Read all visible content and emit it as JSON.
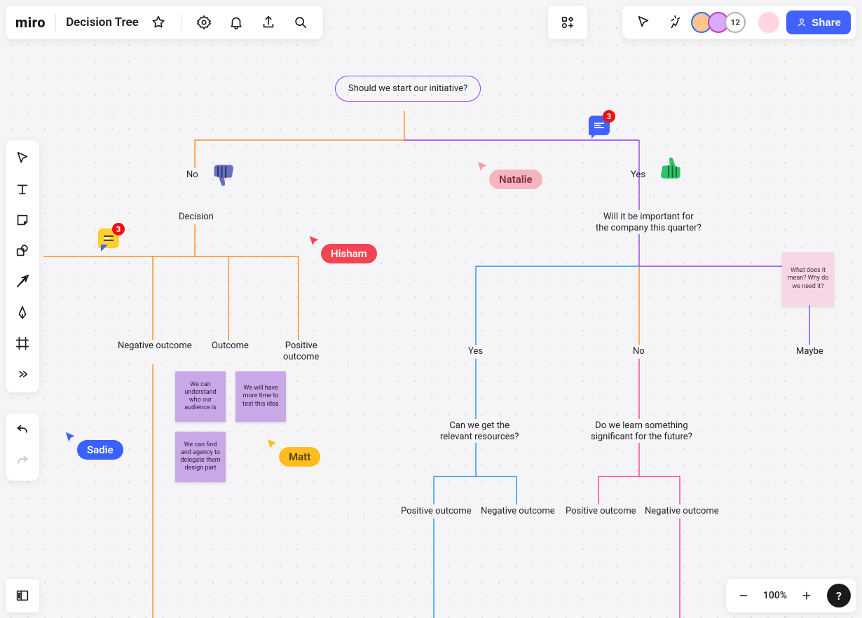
{
  "header": {
    "logo": "miro",
    "board_title": "Decision Tree",
    "user_count": "12"
  },
  "buttons": {
    "share": "Share",
    "help": "?",
    "zoom_level": "100%"
  },
  "comments": {
    "c1_count": "3",
    "c2_count": "3"
  },
  "cursors": {
    "natalie": "Natalie",
    "hisham": "Hisham",
    "sadie": "Sadie",
    "matt": "Matt"
  },
  "nodes": {
    "root": "Should we start our initiative?",
    "no": "No",
    "yes": "Yes",
    "decision": "Decision",
    "important_l1": "Will it be important for",
    "important_l2": "the company this quarter?",
    "neg_outcome": "Negative outcome",
    "outcome": "Outcome",
    "pos_outcome_l1": "Positive",
    "pos_outcome_l2": "outcome",
    "yes2": "Yes",
    "no2": "No",
    "maybe": "Maybe",
    "resources_l1": "Can we get the",
    "resources_l2": "relevant resources?",
    "learn_l1": "Do we learn something",
    "learn_l2": "significant for the future?",
    "po1": "Positive outcome",
    "no1_neg": "Negative outcome",
    "po2": "Positive outcome",
    "no2_neg": "Negative outcome"
  },
  "stickies": {
    "s1": "We can understand who our audience is",
    "s2": "We will have more time to test this idea",
    "s3": "We can find and agency to delegate them design part",
    "s4": "What does it mean? Why do we need it?"
  }
}
